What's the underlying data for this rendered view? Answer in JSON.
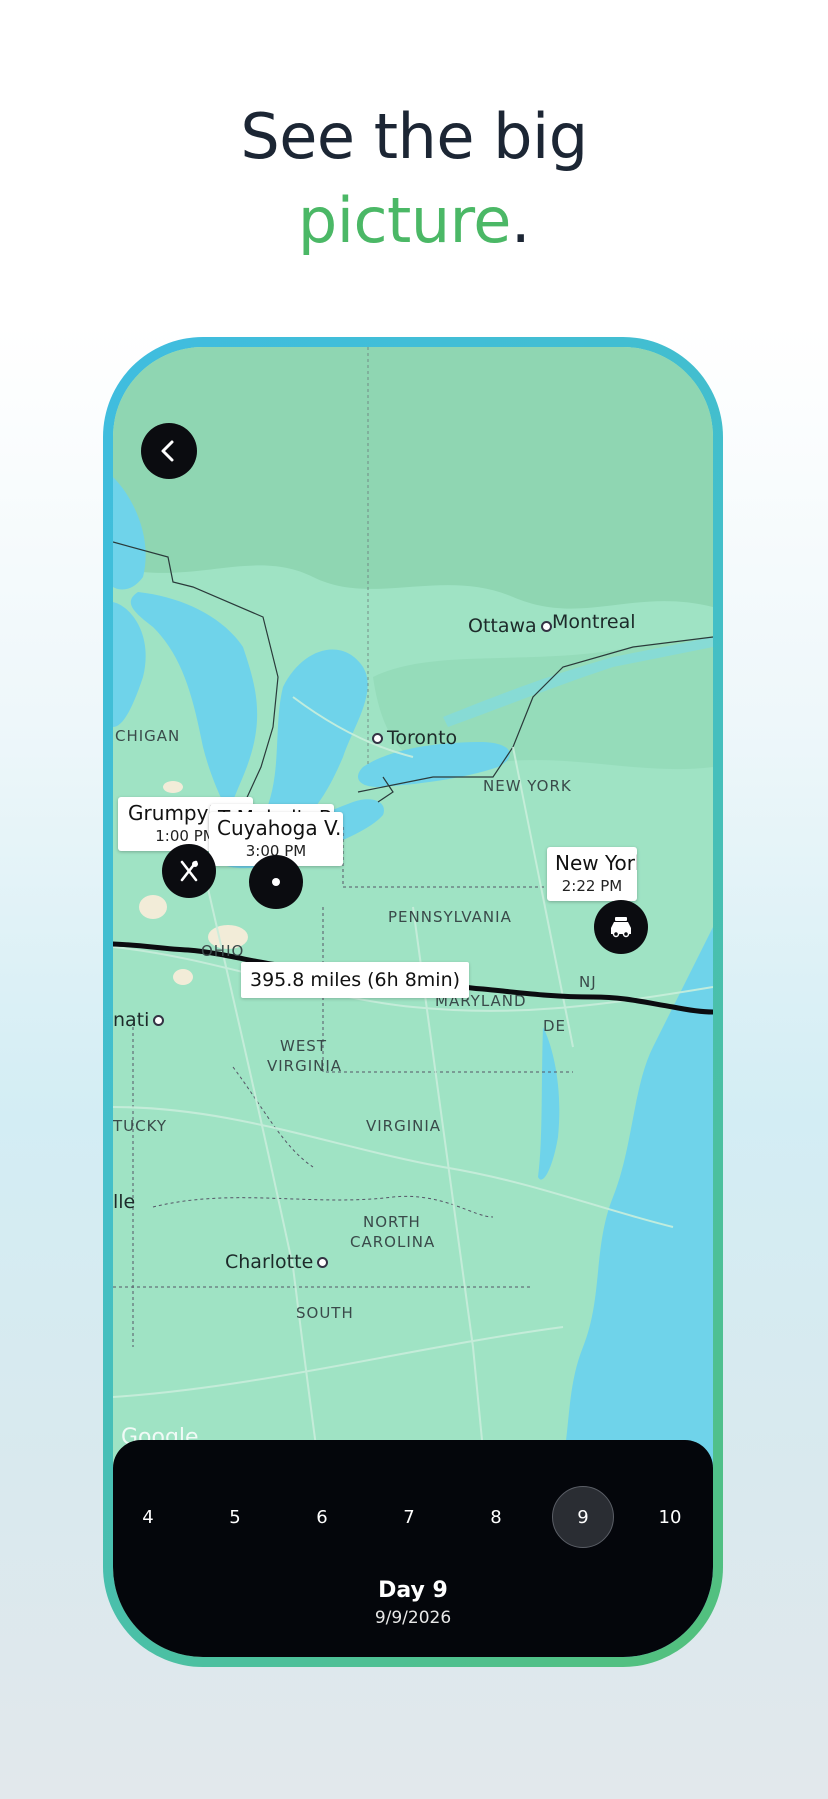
{
  "headline": {
    "line1": "See the big",
    "line2_accent": "picture",
    "line2_suffix": "."
  },
  "map": {
    "labels": {
      "ottawa": "Ottawa",
      "montreal": "Montreal",
      "toronto": "Toronto",
      "michigan": "CHIGAN",
      "new_york_state": "NEW YORK",
      "pennsylvania": "PENNSYLVANIA",
      "ohio": "OHIO",
      "maryland": "MARYLAND",
      "nj": "NJ",
      "de": "DE",
      "cincinnati": "nati",
      "west_virginia_1": "WEST",
      "west_virginia_2": "VIRGINIA",
      "kentucky": "TUCKY",
      "virginia": "VIRGINIA",
      "nashville": "lle",
      "north_carolina_1": "NORTH",
      "north_carolina_2": "CAROLINA",
      "charlotte": "Charlotte",
      "south": "SOUTH",
      "google": "Google"
    },
    "stops": [
      {
        "name": "Grumpy's T",
        "time": "1:00 PM"
      },
      {
        "name": "T Mabel's BBQ",
        "time": ""
      },
      {
        "name": "Cuyahoga V...",
        "time": "3:00 PM"
      },
      {
        "name": "New York...",
        "time": "2:22 PM"
      }
    ],
    "route_distance": "395.8 miles (6h 8min)"
  },
  "days": {
    "items": [
      "4",
      "5",
      "6",
      "7",
      "8",
      "9",
      "10"
    ],
    "selected": "9",
    "title": "Day 9",
    "date": "9/9/2026"
  },
  "colors": {
    "accent": "#4bb866",
    "land": "#9fe3c4",
    "water": "#6fd3ea",
    "route": "#0b0c10"
  }
}
